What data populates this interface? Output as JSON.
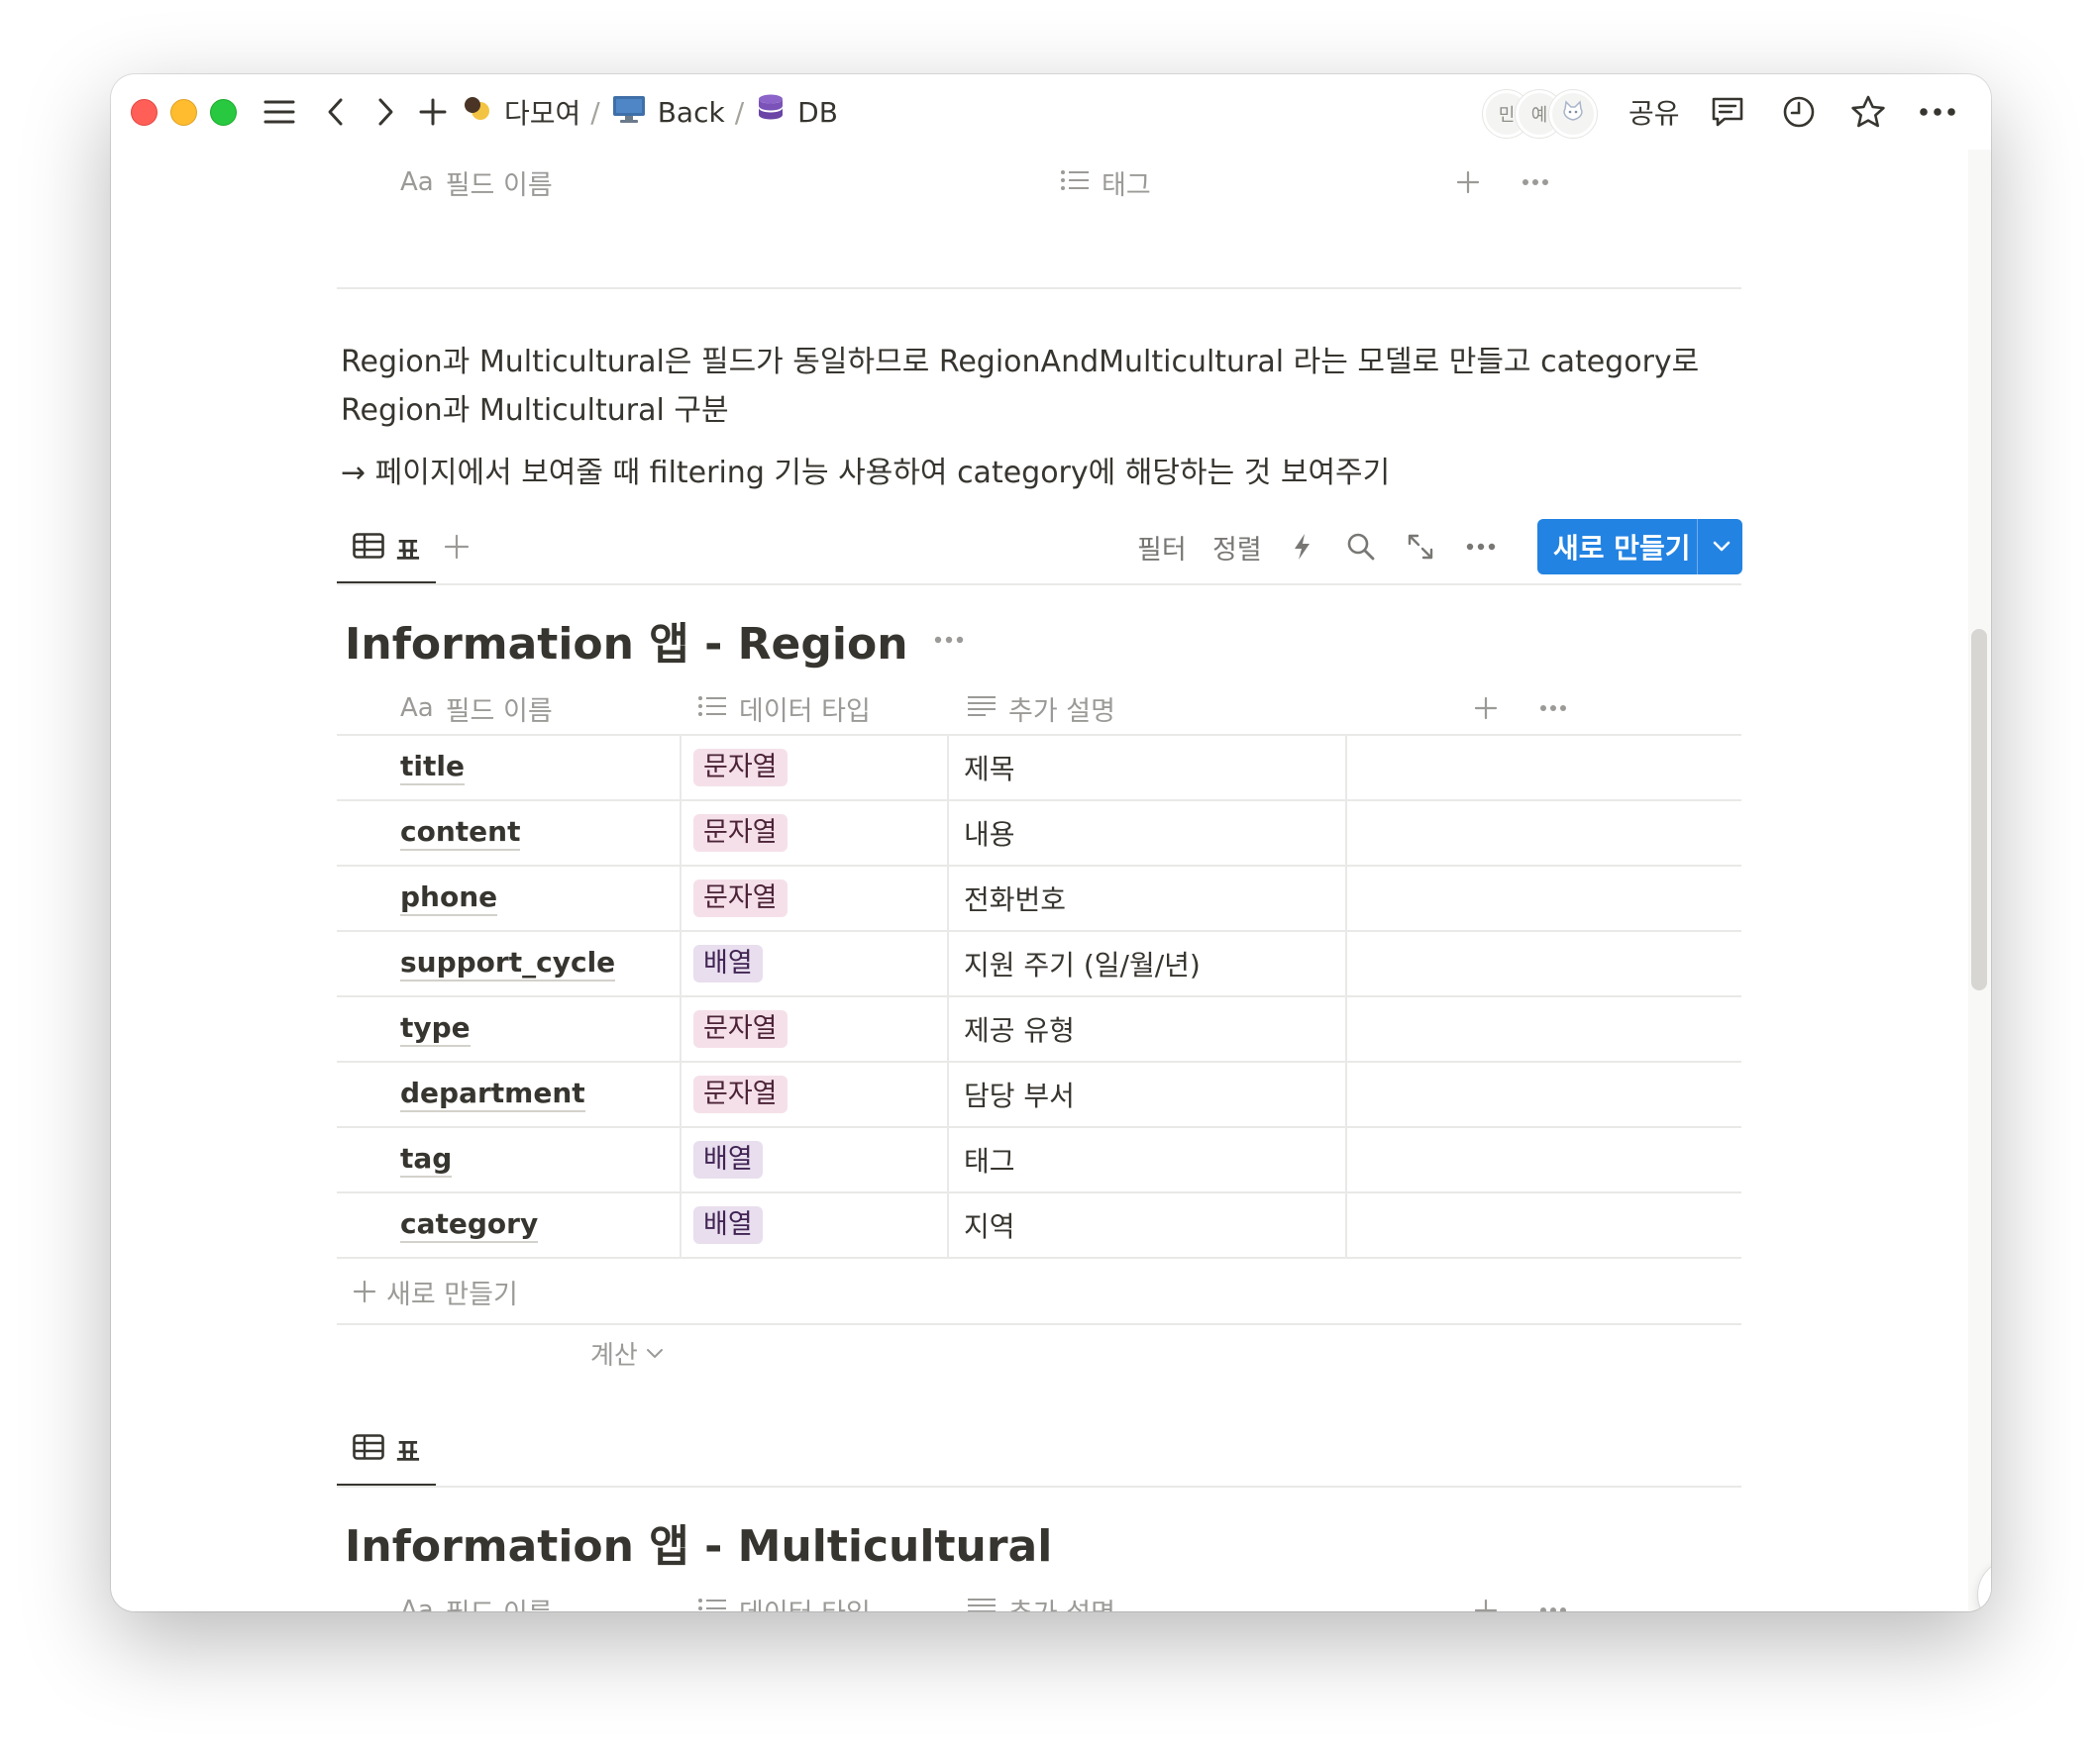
{
  "titlebar": {
    "breadcrumbs": [
      {
        "label": "다모여",
        "icon": "workspace-emoji-icon"
      },
      {
        "label": "Back",
        "icon": "computer-icon"
      },
      {
        "label": "DB",
        "icon": "database-icon"
      }
    ],
    "avatars": [
      "민",
      "예"
    ],
    "share_label": "공유"
  },
  "prev_table_header": {
    "name_prefix": "Aa",
    "name_label": "필드 이름",
    "tag_label": "태그"
  },
  "description": {
    "line1": "Region과 Multicultural은 필드가 동일하므로 RegionAndMulticultural 라는 모델로 만들고 category로",
    "line2": "Region과 Multicultural 구분",
    "line3": "→ 페이지에서 보여줄 때 filtering 기능 사용하여 category에 해당하는 것 보여주기"
  },
  "view_toolbar": {
    "tab_label": "표",
    "filter_label": "필터",
    "sort_label": "정렬",
    "new_button_label": "새로 만들기"
  },
  "region_db": {
    "title": "Information 앱 - Region",
    "columns": {
      "name_prefix": "Aa",
      "name": "필드 이름",
      "type": "데이터 타입",
      "desc": "추가 설명"
    },
    "rows": [
      {
        "name": "title",
        "type": "문자열",
        "kind": "str",
        "desc": "제목"
      },
      {
        "name": "content",
        "type": "문자열",
        "kind": "str",
        "desc": "내용"
      },
      {
        "name": "phone",
        "type": "문자열",
        "kind": "str",
        "desc": "전화번호"
      },
      {
        "name": "support_cycle",
        "type": "배열",
        "kind": "arr",
        "desc": "지원 주기 (일/월/년)"
      },
      {
        "name": "type",
        "type": "문자열",
        "kind": "str",
        "desc": "제공 유형"
      },
      {
        "name": "department",
        "type": "문자열",
        "kind": "str",
        "desc": "담당 부서"
      },
      {
        "name": "tag",
        "type": "배열",
        "kind": "arr",
        "desc": "태그"
      },
      {
        "name": "category",
        "type": "배열",
        "kind": "arr",
        "desc": "지역"
      }
    ],
    "add_row_label": "새로 만들기",
    "calc_label": "계산"
  },
  "multicultural_db": {
    "tab_label": "표",
    "title": "Information 앱 - Multicultural",
    "columns": {
      "name_prefix": "Aa",
      "name": "필드 이름",
      "type": "데이터 타입",
      "desc": "추가 설명"
    }
  },
  "help_label": "?",
  "colors": {
    "accent": "#2383e2",
    "tag_string_bg": "#f5e0e9",
    "tag_array_bg": "#e8deee"
  }
}
